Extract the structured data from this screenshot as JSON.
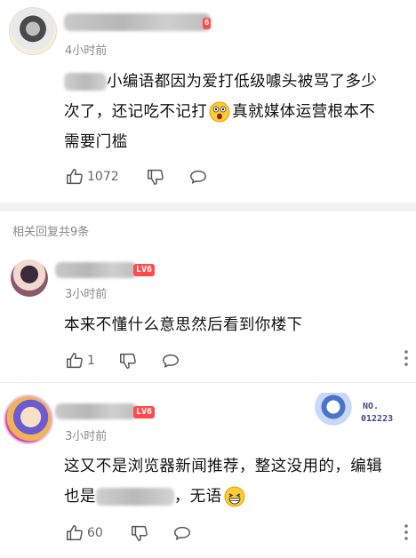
{
  "comment_main": {
    "time": "4小时前",
    "text_a": "小编语都因为爱打低级噱头被骂了多少",
    "text_b": "次了，还记吃不记打",
    "text_c": "真就媒体运营根本不",
    "text_d": "需要门槛",
    "like_count": "1072",
    "level_tag": "6"
  },
  "replies": {
    "header": "相关回复共9条",
    "items": [
      {
        "level": "LV6",
        "time": "3小时前",
        "text_line1": "本来不懂什么意思然后看到你楼下",
        "like_count": "1"
      },
      {
        "level": "LV6",
        "time": "3小时前",
        "text_line1": "这又不是浏览器新闻推荐，整这没用的，编辑",
        "text_line2_a": "也是",
        "text_line2_b": "，无语",
        "like_count": "60",
        "badge_no": "NO.",
        "badge_num": "012223"
      }
    ]
  },
  "colors": {
    "level_badge": "#ff4b4b",
    "muted_text": "#8a8a8a",
    "icon_gray": "#555555"
  },
  "icons": [
    "thumbs-up-icon",
    "thumbs-down-icon",
    "comment-bubble-icon",
    "grimacing-emoji-icon",
    "laughing-emoji-icon"
  ]
}
